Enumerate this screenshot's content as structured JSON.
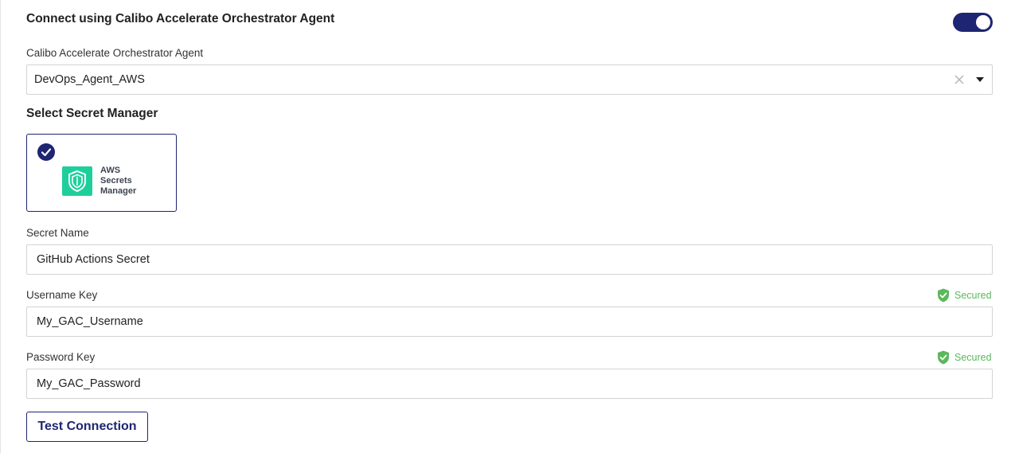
{
  "connect": {
    "title": "Connect using Calibo Accelerate Orchestrator Agent",
    "toggle_on": true,
    "toggle_color": "#1e2572"
  },
  "agent": {
    "label": "Calibo Accelerate Orchestrator Agent",
    "selected_value": "DevOps_Agent_AWS",
    "clear_icon": "close-icon",
    "dropdown_icon": "caret-down-icon"
  },
  "secret_manager": {
    "title": "Select Secret Manager",
    "options": [
      {
        "line1": "AWS",
        "line2": "Secrets",
        "line3": "Manager",
        "selected": true,
        "icon": "aws-secrets-manager-logo"
      }
    ],
    "logo_color": "#1ecf9c"
  },
  "secret_name": {
    "label": "Secret Name",
    "value": "GitHub Actions Secret"
  },
  "username_key": {
    "label": "Username Key",
    "value": "My_GAC_Username",
    "status": "Secured",
    "status_icon": "shield-check-icon"
  },
  "password_key": {
    "label": "Password Key",
    "value": "My_GAC_Password",
    "status": "Secured",
    "status_icon": "shield-check-icon"
  },
  "actions": {
    "test_connection": "Test Connection"
  },
  "colors": {
    "accent": "#1e2572",
    "secured": "#5cb85c"
  }
}
